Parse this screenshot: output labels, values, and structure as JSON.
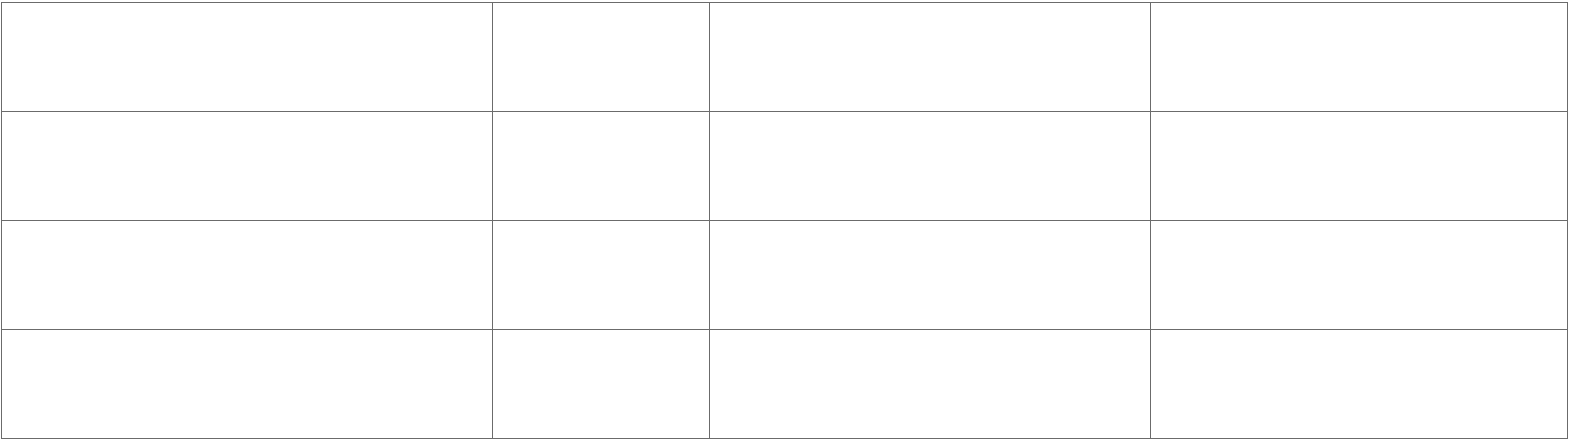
{
  "table": {
    "rows": [
      [
        "",
        "",
        "",
        ""
      ],
      [
        "",
        "",
        "",
        ""
      ],
      [
        "",
        "",
        "",
        ""
      ],
      [
        "",
        "",
        "",
        ""
      ]
    ]
  }
}
